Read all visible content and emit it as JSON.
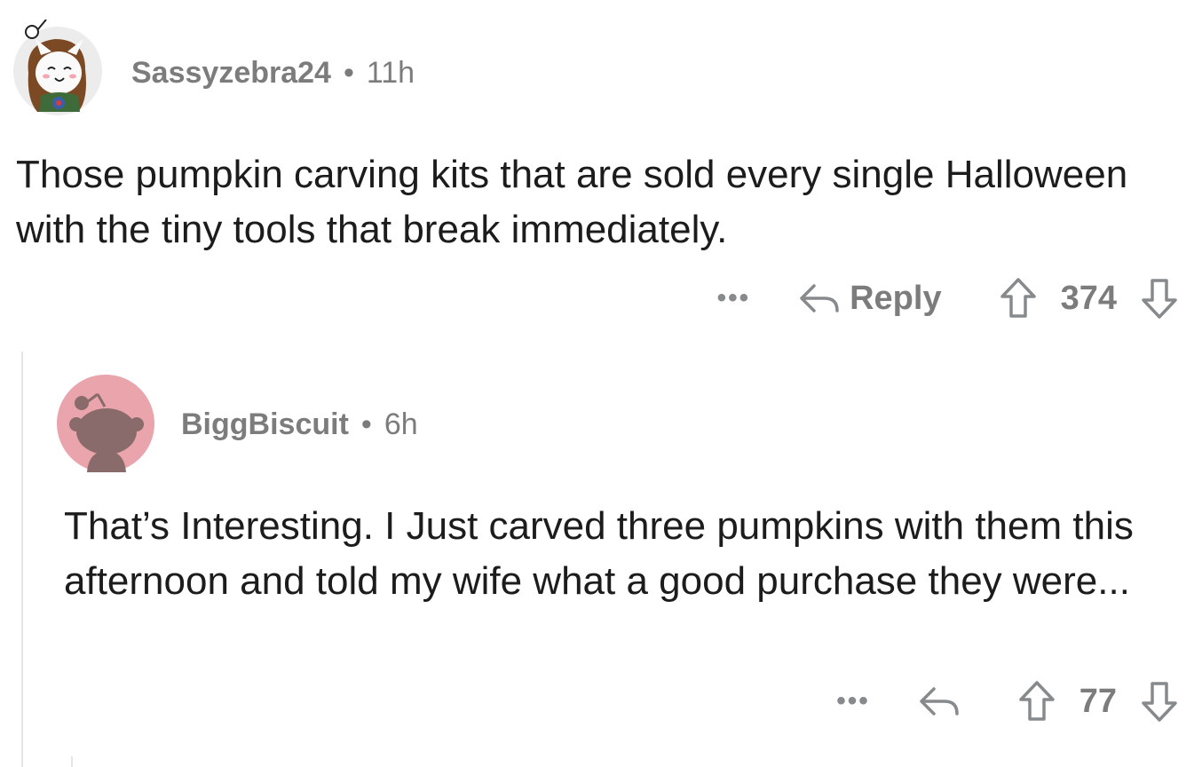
{
  "comments": [
    {
      "author": "Sassyzebra24",
      "separator": "•",
      "age": "11h",
      "text": "Those pumpkin carving kits that are sold every single Halloween with the tiny tools that break immediately.",
      "more_label": "•••",
      "reply_label": "Reply",
      "score": "374"
    },
    {
      "author": "BiggBiscuit",
      "separator": "•",
      "age": "6h",
      "text": "That’s Interesting. I Just carved three pumpkins with them this afternoon and told my wife what a good purchase they were...",
      "more_label": "•••",
      "score": "77"
    }
  ],
  "colors": {
    "meta_gray": "#7c7c7c",
    "icon_gray": "#878a8c",
    "thread_line": "#e5e5e5",
    "reply_avatar_bg": "#e9a4ac"
  }
}
